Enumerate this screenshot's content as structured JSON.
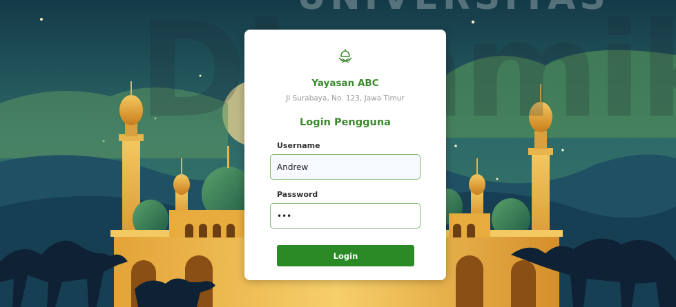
{
  "background": {
    "watermark_top": "UNIVERSITAS",
    "watermark_main": "Dinamika",
    "scene": "mosque-night-camels-illustration"
  },
  "card": {
    "logo_icon": "mosque-dome-logo-icon",
    "org_name": "Yayasan ABC",
    "org_address": "Jl Surabaya, No. 123, Jawa Timur",
    "title": "Login Pengguna"
  },
  "form": {
    "username": {
      "label": "Username",
      "value": "Andrew"
    },
    "password": {
      "label": "Password",
      "value": "abc"
    },
    "login_label": "Login"
  },
  "colors": {
    "brand_green": "#3c8a2e",
    "button_green": "#2b8a26",
    "field_border": "#7fb870"
  }
}
